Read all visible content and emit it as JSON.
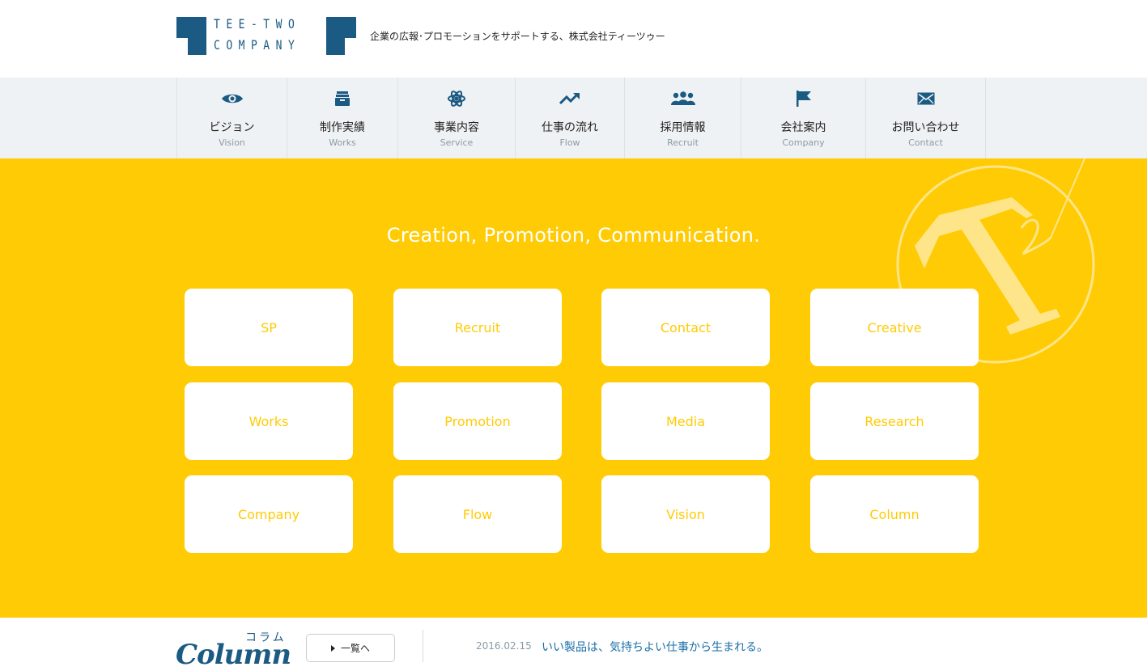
{
  "header": {
    "logo_line1": "TEE-TWO",
    "logo_line2": "COMPANY",
    "tagline": "企業の広報･プロモーションをサポートする、株式会社ティーツゥー"
  },
  "nav": {
    "items": [
      {
        "jp": "ビジョン",
        "en": "Vision",
        "icon": "eye-icon"
      },
      {
        "jp": "制作実績",
        "en": "Works",
        "icon": "archive-box-icon"
      },
      {
        "jp": "事業内容",
        "en": "Service",
        "icon": "atom-icon"
      },
      {
        "jp": "仕事の流れ",
        "en": "Flow",
        "icon": "trend-up-icon"
      },
      {
        "jp": "採用情報",
        "en": "Recruit",
        "icon": "people-group-icon"
      },
      {
        "jp": "会社案内",
        "en": "Company",
        "icon": "flag-icon"
      },
      {
        "jp": "お問い合わせ",
        "en": "Contact",
        "icon": "envelope-icon"
      }
    ]
  },
  "hero": {
    "title": "Creation, Promotion, Communication.",
    "cards": [
      "SP",
      "Recruit",
      "Contact",
      "Creative",
      "Works",
      "Promotion",
      "Media",
      "Research",
      "Company",
      "Flow",
      "Vision",
      "Column"
    ]
  },
  "column": {
    "kana": "コラム",
    "word": "Column",
    "list_button": "一覧へ",
    "date": "2016.02.15",
    "title": "いい製品は、気持ちよい仕事から生まれる。"
  },
  "colors": {
    "brand_blue": "#1b5a82",
    "hero_yellow": "#ffcb05",
    "nav_bg": "#eff2f4",
    "link_blue": "#1b6fa8"
  }
}
